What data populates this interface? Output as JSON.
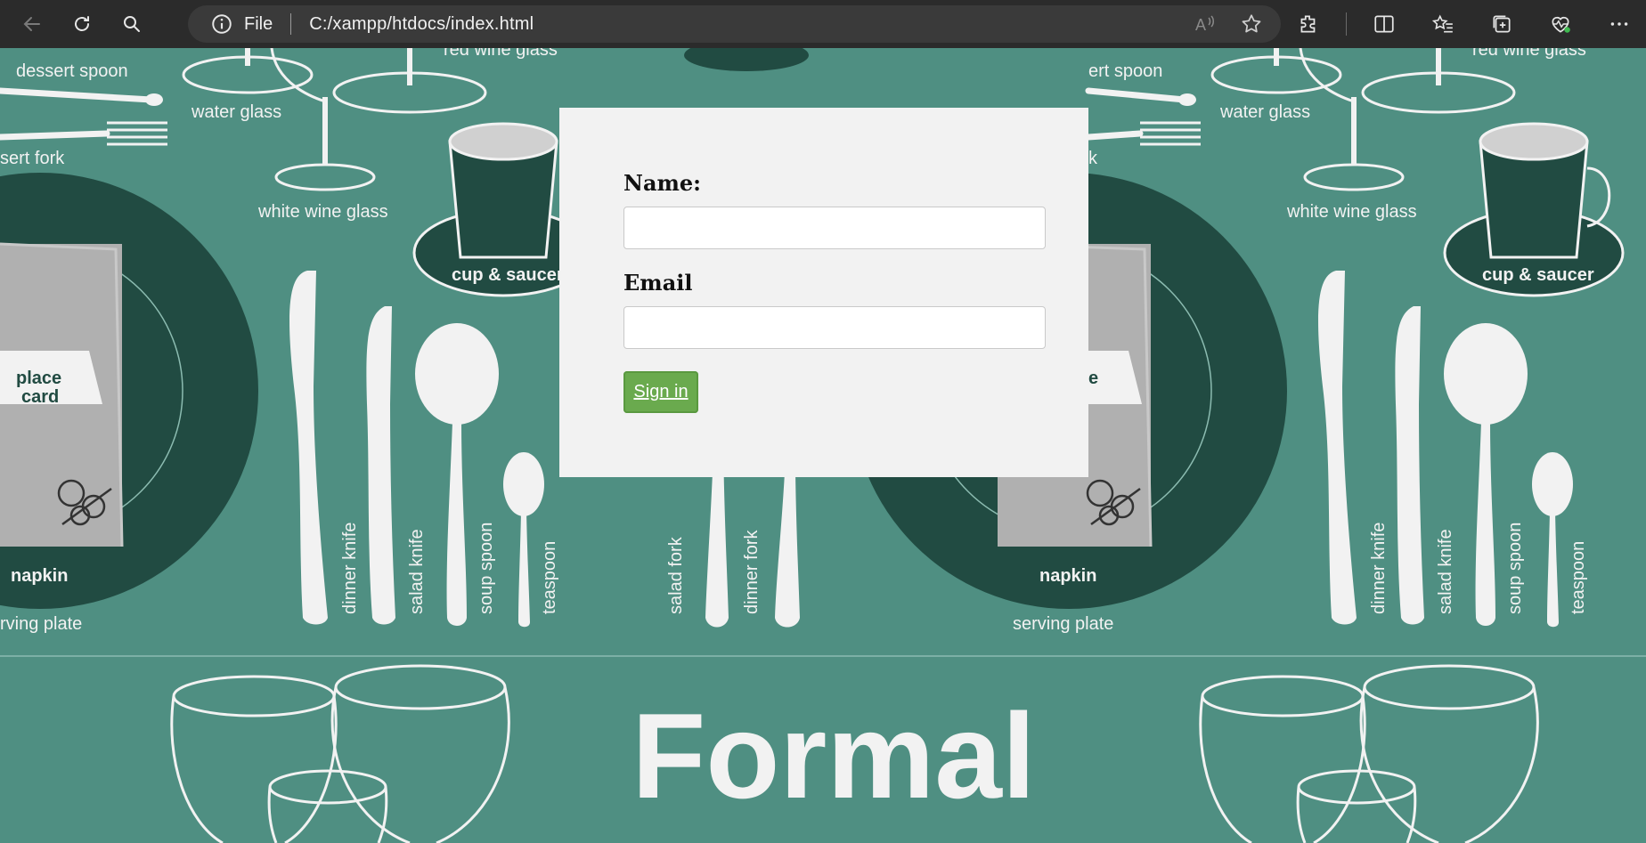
{
  "browser": {
    "scheme": "File",
    "url": "C:/xampp/htdocs/index.html"
  },
  "form": {
    "name_label": "Name:",
    "name_value": "",
    "email_label": "Email",
    "email_value": "",
    "signin_label": "Sign in"
  },
  "background": {
    "title": "Formal",
    "labels": {
      "dessert_spoon": "dessert spoon",
      "dessert_fork_partial": "sert fork",
      "water_glass": "water glass",
      "red_wine_glass": "red wine glass",
      "white_wine_glass": "white wine glass",
      "cup_saucer": "cup & saucer",
      "place_card_1": "place",
      "place_card_2": "card",
      "napkin": "napkin",
      "serving_plate_partial": "rving plate",
      "serving_plate": "serving plate",
      "dinner_knife": "dinner knife",
      "salad_knife": "salad knife",
      "soup_spoon": "soup spoon",
      "teaspoon": "teaspoon",
      "salad_fork": "salad fork",
      "dinner_fork": "dinner fork",
      "right_dessert_spoon": "ert spoon",
      "right_fork_partial": "k",
      "right_place_partial": "e"
    }
  },
  "colors": {
    "background": "#4f8f82",
    "dark_green": "#214b42",
    "card": "#f2f2f2",
    "button": "#6aaa4e"
  }
}
